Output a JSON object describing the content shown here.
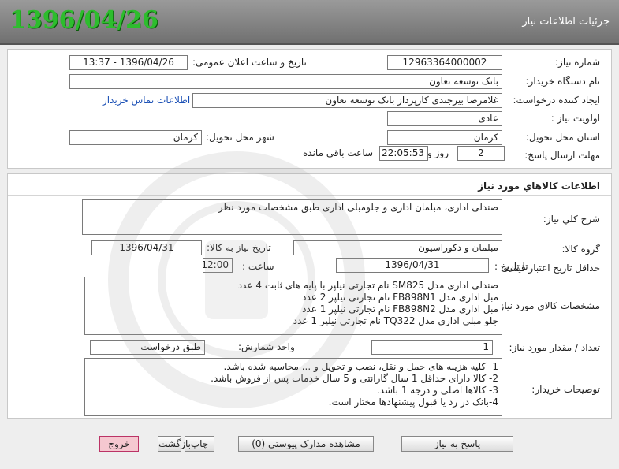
{
  "header": {
    "title": "جزئیات اطلاعات نیاز",
    "date": "1396/04/26"
  },
  "need": {
    "number_label": "شماره نیاز:",
    "number": "12963364000002",
    "announce_label": "تاریخ و ساعت اعلان عمومی:",
    "announce": "1396/04/26 - 13:37",
    "buyer_org_label": "نام دستگاه خریدار:",
    "buyer_org": "بانک توسعه تعاون",
    "creator_label": "ایجاد کننده درخواست:",
    "creator": "غلامرضا  بیرجندی کارپرداز  بانک توسعه تعاون",
    "contact_link": "اطلاعات تماس خریدار",
    "priority_label": "اولویت نیاز :",
    "priority": "عادی",
    "province_label": "استان محل تحویل:",
    "province": "کرمان",
    "city_label": "شهر محل تحویل:",
    "city": "کرمان",
    "deadline_label": "مهلت ارسال پاسخ:",
    "days": "2",
    "days_suffix": "روز و",
    "time": "22:05:53",
    "remaining": "ساعت باقی مانده"
  },
  "goods": {
    "section_title": "اطلاعات کالاهاي مورد نياز",
    "desc_label": "شرح کلي نياز:",
    "desc": "صندلی اداری، مبلمان اداری و جلومبلی اداری طبق مشخصات مورد نظر",
    "group_label": "گروه کالا:",
    "group": "مبلمان و دکوراسیون",
    "need_date_label": "تاریخ نیاز به کالا:",
    "need_date": "1396/04/31",
    "validity_label": "حداقل تاریخ اعتبار قیمت:",
    "until_label": "تا تاریخ :",
    "until_date": "1396/04/31",
    "hour_label": "ساعت :",
    "hour": "12:00",
    "spec_label": "مشخصات کالاي مورد نياز:",
    "spec_lines": [
      "صندلی اداری مدل SM825 نام تجارتی نیلپر با پایه های ثابت 4 عدد",
      "مبل اداری مدل FB898N1 نام تجارتی نیلپر 2 عدد",
      "مبل اداری مدل FB898N2 نام تجارتی نیلپر 1 عدد",
      "جلو مبلی اداری مدل TQ322 نام تجارتی نیلپر 1 عدد"
    ],
    "qty_label": "تعداد / مقدار مورد نیاز:",
    "qty": "1",
    "unit_label": "واحد شمارش:",
    "unit": "طبق درخواست",
    "notes_label": "توضیحات خریدار:",
    "notes_lines": [
      "1- کلیه هزینه های حمل و نقل، نصب و تحویل و ... محاسبه شده باشد.",
      "2- کالا دارای حداقل 1 سال گارانتی و 5 سال خدمات پس از فروش باشد.",
      "3- کالاها اصلی و درجه 1 باشد.",
      "4-بانک در رد یا قبول پیشنهادها مختار است."
    ]
  },
  "buttons": {
    "reply": "پاسخ به نیاز",
    "attachments": "مشاهده مدارک پیوستی (0)",
    "print": "چاپ",
    "back": "بازگشت",
    "exit": "خروج"
  }
}
